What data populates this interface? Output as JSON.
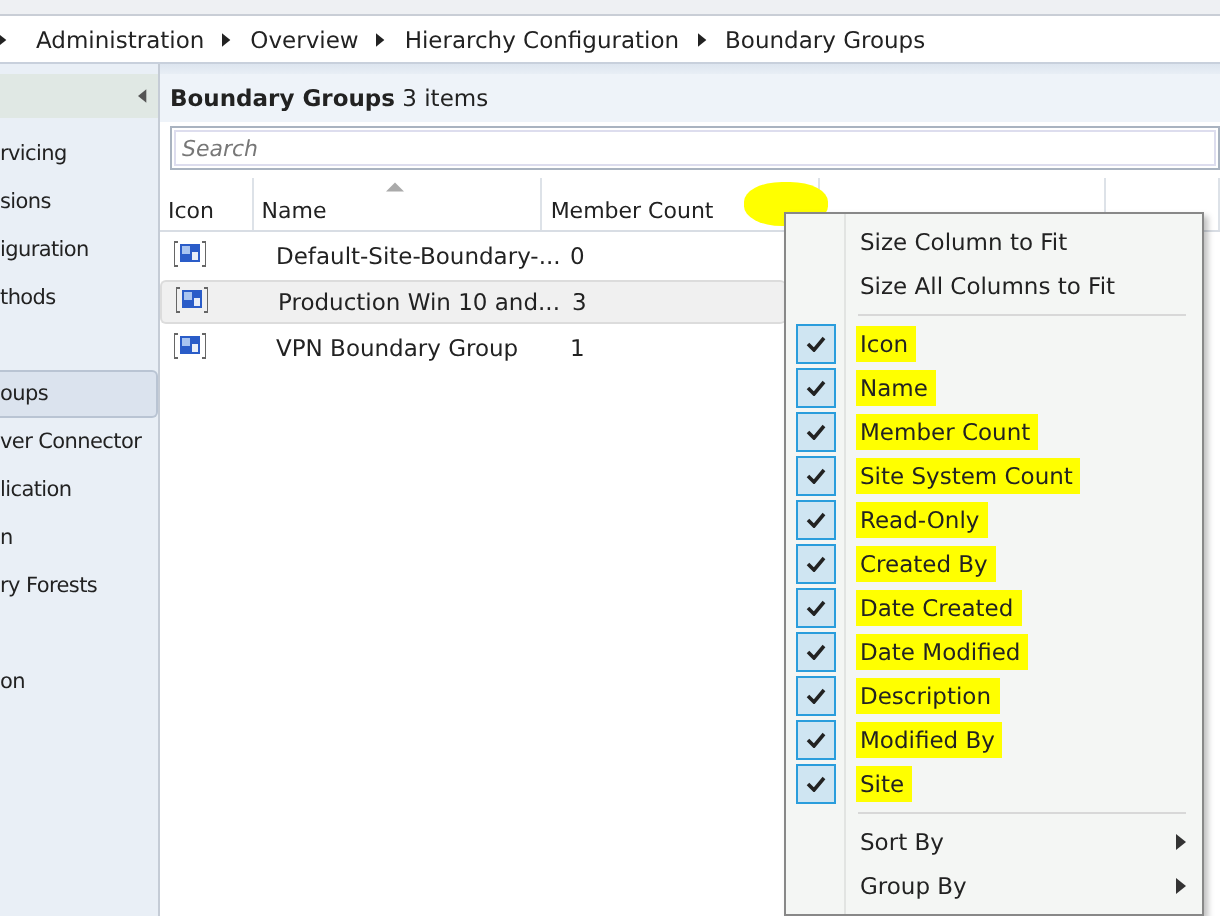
{
  "breadcrumb": [
    "Administration",
    "Overview",
    "Hierarchy Configuration",
    "Boundary Groups"
  ],
  "sidebar": {
    "items": [
      {
        "label": "rvicing",
        "selected": false
      },
      {
        "label": "sions",
        "selected": false
      },
      {
        "label": "iguration",
        "selected": false
      },
      {
        "label": "thods",
        "selected": false
      },
      {
        "label": "oups",
        "selected": true
      },
      {
        "label": "ver Connector",
        "selected": false
      },
      {
        "label": "lication",
        "selected": false
      },
      {
        "label": "n",
        "selected": false
      },
      {
        "label": "ry Forests",
        "selected": false
      },
      {
        "label": "on",
        "selected": false
      }
    ]
  },
  "list": {
    "title": "Boundary Groups",
    "count": "3 items",
    "search": {
      "placeholder": "Search"
    },
    "columns": [
      "Icon",
      "Name",
      "Member Count"
    ],
    "rows": [
      {
        "name": "Default-Site-Boundary-...",
        "member_count": "0",
        "selected": false
      },
      {
        "name": "Production Win 10 and...",
        "member_count": "3",
        "selected": true
      },
      {
        "name": "VPN Boundary Group",
        "member_count": "1",
        "selected": false
      }
    ]
  },
  "context_menu": {
    "items": [
      {
        "kind": "action",
        "label": "Size Column to Fit"
      },
      {
        "kind": "action",
        "label": "Size All Columns to Fit"
      },
      {
        "kind": "separator"
      },
      {
        "kind": "check",
        "label": "Icon",
        "checked": true,
        "highlighted": true
      },
      {
        "kind": "check",
        "label": "Name",
        "checked": true,
        "highlighted": true
      },
      {
        "kind": "check",
        "label": "Member Count",
        "checked": true,
        "highlighted": true
      },
      {
        "kind": "check",
        "label": "Site System Count",
        "checked": true,
        "highlighted": true
      },
      {
        "kind": "check",
        "label": "Read-Only",
        "checked": true,
        "highlighted": true
      },
      {
        "kind": "check",
        "label": "Created By",
        "checked": true,
        "highlighted": true
      },
      {
        "kind": "check",
        "label": "Date Created",
        "checked": true,
        "highlighted": true
      },
      {
        "kind": "check",
        "label": "Date Modified",
        "checked": true,
        "highlighted": true
      },
      {
        "kind": "check",
        "label": "Description",
        "checked": true,
        "highlighted": true
      },
      {
        "kind": "check",
        "label": "Modified By",
        "checked": true,
        "highlighted": true
      },
      {
        "kind": "check",
        "label": "Site",
        "checked": true,
        "highlighted": true
      },
      {
        "kind": "separator"
      },
      {
        "kind": "submenu",
        "label": "Sort By"
      },
      {
        "kind": "submenu",
        "label": "Group By"
      }
    ]
  }
}
